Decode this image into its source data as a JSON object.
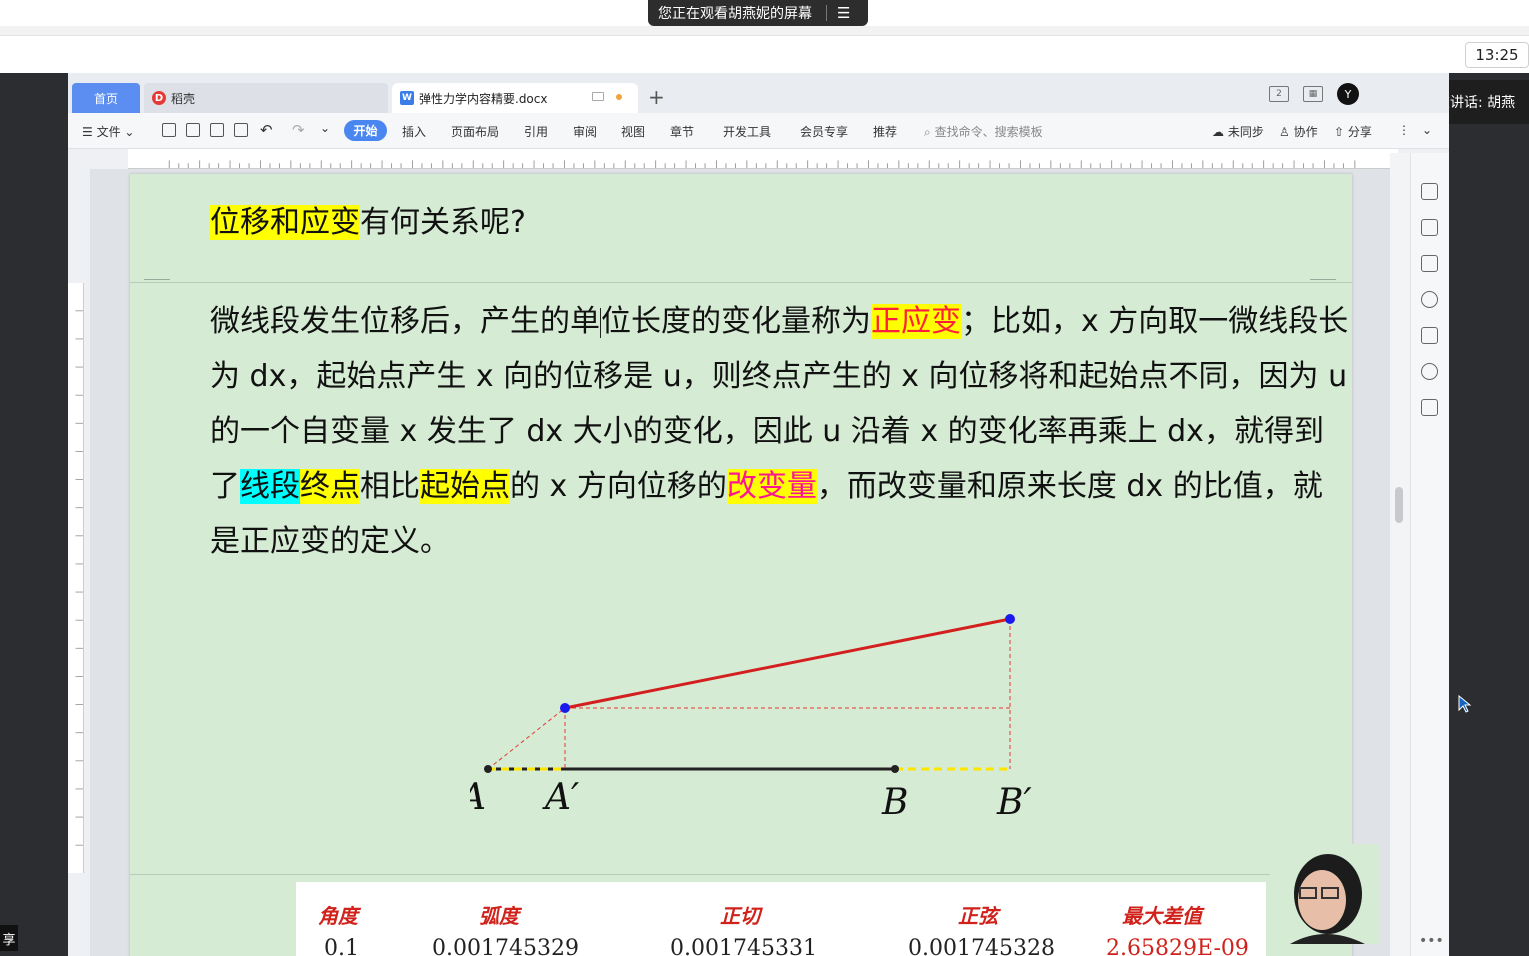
{
  "screen_share": {
    "banner_text": "您正在观看胡燕妮的屏幕",
    "menu_icon": "list-menu-icon",
    "time": "13:25",
    "speaking_text": "正在讲话: 胡燕",
    "share_tag": "享"
  },
  "wps": {
    "tabs": [
      {
        "label": "首页"
      },
      {
        "label": "稻壳"
      },
      {
        "label": "弹性力学内容精要.docx"
      }
    ],
    "new_tab": "+",
    "ribbon": {
      "file": "文件",
      "tabs": [
        "开始",
        "插入",
        "页面布局",
        "引用",
        "审阅",
        "视图",
        "章节",
        "开发工具",
        "会员专享",
        "推荐"
      ],
      "active_tab": "开始",
      "search_placeholder": "查找命令、搜索模板",
      "sync": "未同步",
      "collab": "协作",
      "share": "分享"
    },
    "accent_color": "#4a86f0"
  },
  "document": {
    "heading": {
      "hl": "位移和应变",
      "rest": "有何关系呢?"
    },
    "paragraph": {
      "p1": "微线段发生位移后，产生的单",
      "p2": "位长度的变化量称为",
      "term1": "正应变",
      "p3": "；比如，x 方向取一微线段长为 dx，起始点产生 x 向的位移是 u，则终点产生的 x 向位移将和起始点不同，因为 u 的一个自变量 x 发生了 dx 大小的变化，因此 u 沿着 x 的变化率再乘上 dx，就得到了",
      "term2": "线段",
      "term3": "终点",
      "p4": "相比",
      "term4": "起始点",
      "p5": "的 x 方向位移的",
      "term5": "改变量",
      "p6": "，而改变量和原来长度 dx 的比值，就是正应变的定义。"
    },
    "diagram_labels": {
      "A": "A",
      "A_prime": "A′",
      "B": "B",
      "B_prime": "B′"
    },
    "table": {
      "headers": [
        "角度",
        "弧度",
        "正切",
        "正弦",
        "最大差值"
      ],
      "row": [
        "0.1",
        "0.001745329",
        "0.001745331",
        "0.001745328",
        "2.65829E-09"
      ]
    }
  }
}
